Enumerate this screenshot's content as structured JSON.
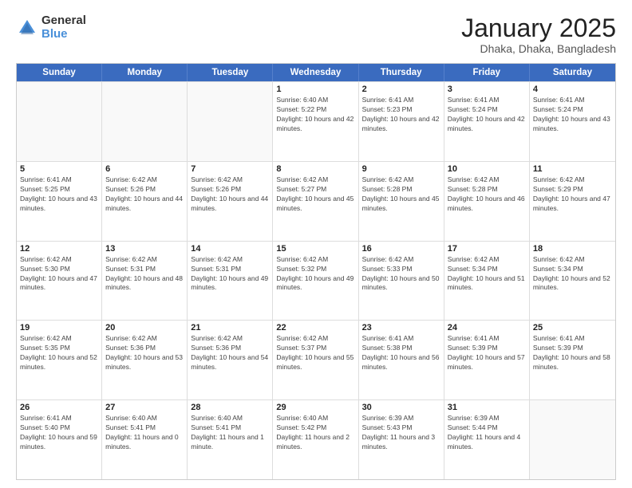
{
  "logo": {
    "general": "General",
    "blue": "Blue"
  },
  "header": {
    "title": "January 2025",
    "subtitle": "Dhaka, Dhaka, Bangladesh"
  },
  "weekdays": [
    "Sunday",
    "Monday",
    "Tuesday",
    "Wednesday",
    "Thursday",
    "Friday",
    "Saturday"
  ],
  "rows": [
    [
      {
        "day": "",
        "sunrise": "",
        "sunset": "",
        "daylight": "",
        "empty": true
      },
      {
        "day": "",
        "sunrise": "",
        "sunset": "",
        "daylight": "",
        "empty": true
      },
      {
        "day": "",
        "sunrise": "",
        "sunset": "",
        "daylight": "",
        "empty": true
      },
      {
        "day": "1",
        "sunrise": "Sunrise: 6:40 AM",
        "sunset": "Sunset: 5:22 PM",
        "daylight": "Daylight: 10 hours and 42 minutes."
      },
      {
        "day": "2",
        "sunrise": "Sunrise: 6:41 AM",
        "sunset": "Sunset: 5:23 PM",
        "daylight": "Daylight: 10 hours and 42 minutes."
      },
      {
        "day": "3",
        "sunrise": "Sunrise: 6:41 AM",
        "sunset": "Sunset: 5:24 PM",
        "daylight": "Daylight: 10 hours and 42 minutes."
      },
      {
        "day": "4",
        "sunrise": "Sunrise: 6:41 AM",
        "sunset": "Sunset: 5:24 PM",
        "daylight": "Daylight: 10 hours and 43 minutes."
      }
    ],
    [
      {
        "day": "5",
        "sunrise": "Sunrise: 6:41 AM",
        "sunset": "Sunset: 5:25 PM",
        "daylight": "Daylight: 10 hours and 43 minutes."
      },
      {
        "day": "6",
        "sunrise": "Sunrise: 6:42 AM",
        "sunset": "Sunset: 5:26 PM",
        "daylight": "Daylight: 10 hours and 44 minutes."
      },
      {
        "day": "7",
        "sunrise": "Sunrise: 6:42 AM",
        "sunset": "Sunset: 5:26 PM",
        "daylight": "Daylight: 10 hours and 44 minutes."
      },
      {
        "day": "8",
        "sunrise": "Sunrise: 6:42 AM",
        "sunset": "Sunset: 5:27 PM",
        "daylight": "Daylight: 10 hours and 45 minutes."
      },
      {
        "day": "9",
        "sunrise": "Sunrise: 6:42 AM",
        "sunset": "Sunset: 5:28 PM",
        "daylight": "Daylight: 10 hours and 45 minutes."
      },
      {
        "day": "10",
        "sunrise": "Sunrise: 6:42 AM",
        "sunset": "Sunset: 5:28 PM",
        "daylight": "Daylight: 10 hours and 46 minutes."
      },
      {
        "day": "11",
        "sunrise": "Sunrise: 6:42 AM",
        "sunset": "Sunset: 5:29 PM",
        "daylight": "Daylight: 10 hours and 47 minutes."
      }
    ],
    [
      {
        "day": "12",
        "sunrise": "Sunrise: 6:42 AM",
        "sunset": "Sunset: 5:30 PM",
        "daylight": "Daylight: 10 hours and 47 minutes."
      },
      {
        "day": "13",
        "sunrise": "Sunrise: 6:42 AM",
        "sunset": "Sunset: 5:31 PM",
        "daylight": "Daylight: 10 hours and 48 minutes."
      },
      {
        "day": "14",
        "sunrise": "Sunrise: 6:42 AM",
        "sunset": "Sunset: 5:31 PM",
        "daylight": "Daylight: 10 hours and 49 minutes."
      },
      {
        "day": "15",
        "sunrise": "Sunrise: 6:42 AM",
        "sunset": "Sunset: 5:32 PM",
        "daylight": "Daylight: 10 hours and 49 minutes."
      },
      {
        "day": "16",
        "sunrise": "Sunrise: 6:42 AM",
        "sunset": "Sunset: 5:33 PM",
        "daylight": "Daylight: 10 hours and 50 minutes."
      },
      {
        "day": "17",
        "sunrise": "Sunrise: 6:42 AM",
        "sunset": "Sunset: 5:34 PM",
        "daylight": "Daylight: 10 hours and 51 minutes."
      },
      {
        "day": "18",
        "sunrise": "Sunrise: 6:42 AM",
        "sunset": "Sunset: 5:34 PM",
        "daylight": "Daylight: 10 hours and 52 minutes."
      }
    ],
    [
      {
        "day": "19",
        "sunrise": "Sunrise: 6:42 AM",
        "sunset": "Sunset: 5:35 PM",
        "daylight": "Daylight: 10 hours and 52 minutes."
      },
      {
        "day": "20",
        "sunrise": "Sunrise: 6:42 AM",
        "sunset": "Sunset: 5:36 PM",
        "daylight": "Daylight: 10 hours and 53 minutes."
      },
      {
        "day": "21",
        "sunrise": "Sunrise: 6:42 AM",
        "sunset": "Sunset: 5:36 PM",
        "daylight": "Daylight: 10 hours and 54 minutes."
      },
      {
        "day": "22",
        "sunrise": "Sunrise: 6:42 AM",
        "sunset": "Sunset: 5:37 PM",
        "daylight": "Daylight: 10 hours and 55 minutes."
      },
      {
        "day": "23",
        "sunrise": "Sunrise: 6:41 AM",
        "sunset": "Sunset: 5:38 PM",
        "daylight": "Daylight: 10 hours and 56 minutes."
      },
      {
        "day": "24",
        "sunrise": "Sunrise: 6:41 AM",
        "sunset": "Sunset: 5:39 PM",
        "daylight": "Daylight: 10 hours and 57 minutes."
      },
      {
        "day": "25",
        "sunrise": "Sunrise: 6:41 AM",
        "sunset": "Sunset: 5:39 PM",
        "daylight": "Daylight: 10 hours and 58 minutes."
      }
    ],
    [
      {
        "day": "26",
        "sunrise": "Sunrise: 6:41 AM",
        "sunset": "Sunset: 5:40 PM",
        "daylight": "Daylight: 10 hours and 59 minutes."
      },
      {
        "day": "27",
        "sunrise": "Sunrise: 6:40 AM",
        "sunset": "Sunset: 5:41 PM",
        "daylight": "Daylight: 11 hours and 0 minutes."
      },
      {
        "day": "28",
        "sunrise": "Sunrise: 6:40 AM",
        "sunset": "Sunset: 5:41 PM",
        "daylight": "Daylight: 11 hours and 1 minute."
      },
      {
        "day": "29",
        "sunrise": "Sunrise: 6:40 AM",
        "sunset": "Sunset: 5:42 PM",
        "daylight": "Daylight: 11 hours and 2 minutes."
      },
      {
        "day": "30",
        "sunrise": "Sunrise: 6:39 AM",
        "sunset": "Sunset: 5:43 PM",
        "daylight": "Daylight: 11 hours and 3 minutes."
      },
      {
        "day": "31",
        "sunrise": "Sunrise: 6:39 AM",
        "sunset": "Sunset: 5:44 PM",
        "daylight": "Daylight: 11 hours and 4 minutes."
      },
      {
        "day": "",
        "sunrise": "",
        "sunset": "",
        "daylight": "",
        "empty": true
      }
    ]
  ]
}
